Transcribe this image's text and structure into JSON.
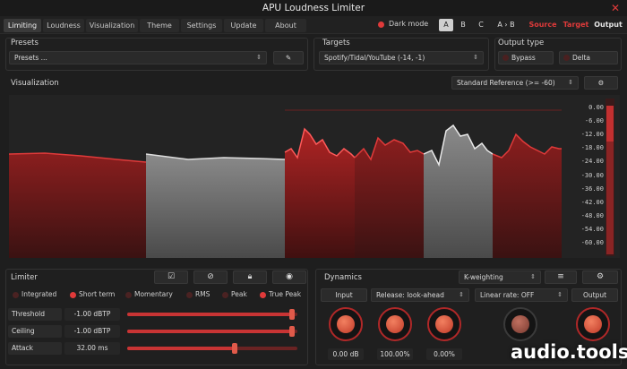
{
  "app": {
    "title": "APU Loudness Limiter"
  },
  "menu": {
    "tabs": [
      "Limiting",
      "Loudness",
      "Visualization",
      "Theme",
      "Settings",
      "Update",
      "About"
    ],
    "active": "Limiting"
  },
  "header": {
    "dark_mode_label": "Dark mode",
    "ab": [
      "A",
      "B",
      "C",
      "A › B"
    ],
    "ab_selected": "A",
    "source_label": "Source",
    "target_label": "Target",
    "output_label": "Output"
  },
  "presets": {
    "title": "Presets",
    "value": "Presets ..."
  },
  "targets": {
    "title": "Targets",
    "value": "Spotify/Tidal/YouTube (-14, -1)"
  },
  "output_type": {
    "title": "Output type",
    "bypass": "Bypass",
    "delta": "Delta"
  },
  "visualization": {
    "title": "Visualization",
    "reference": "Standard Reference (>= -60)",
    "scale": [
      "0.00",
      "-6.00",
      "-12.00",
      "-18.00",
      "-24.00",
      "-30.00",
      "-36.00",
      "-42.00",
      "-48.00",
      "-54.00",
      "-60.00"
    ]
  },
  "limiter": {
    "title": "Limiter",
    "modes": [
      {
        "label": "Integrated",
        "on": false
      },
      {
        "label": "Short term",
        "on": true
      },
      {
        "label": "Momentary",
        "on": false
      },
      {
        "label": "RMS",
        "on": false
      },
      {
        "label": "Peak",
        "on": false
      },
      {
        "label": "True Peak",
        "on": true
      }
    ],
    "params": [
      {
        "label": "Threshold",
        "value": "-1.00 dBTP",
        "level": 0.97
      },
      {
        "label": "Ceiling",
        "value": "-1.00 dBTP",
        "level": 0.97
      },
      {
        "label": "Attack",
        "value": "32.00 ms",
        "level": 0.63
      }
    ]
  },
  "dynamics": {
    "title": "Dynamics",
    "weighting": "K-weighting",
    "input_label": "Input",
    "release": "Release: look-ahead",
    "rate": "Linear rate: OFF",
    "output_label": "Output",
    "knob_values": [
      "0.00 dB",
      "100.00%",
      "0.00%"
    ]
  },
  "watermark": "audio.tools",
  "colors": {
    "accent": "#e03a3a",
    "background": "#1e1e1e"
  }
}
